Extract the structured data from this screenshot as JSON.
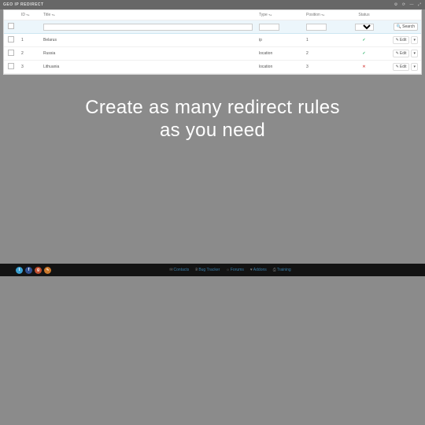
{
  "panel": {
    "title": "GEO IP REDIRECT"
  },
  "table": {
    "headers": {
      "id": "ID",
      "title": "Title",
      "type": "Type",
      "position": "Position",
      "status": "Status"
    },
    "search_label": "Search",
    "edit_label": "Edit",
    "rows": [
      {
        "id": "1",
        "title": "Belarus",
        "type": "ip",
        "position": "1",
        "status": "on"
      },
      {
        "id": "2",
        "title": "Russia",
        "type": "location",
        "position": "2",
        "status": "on"
      },
      {
        "id": "3",
        "title": "Lithuania",
        "type": "location",
        "position": "3",
        "status": "off"
      }
    ]
  },
  "hero": {
    "line1": "Create as many redirect rules",
    "line2": "as you need"
  },
  "footer": {
    "links": [
      {
        "icon": "✉",
        "label": "Contacts"
      },
      {
        "icon": "𐌁",
        "label": "Bug Tracker"
      },
      {
        "icon": "☼",
        "label": "Forums"
      },
      {
        "icon": "♥",
        "label": "Addons"
      },
      {
        "icon": "⎙",
        "label": "Training"
      }
    ]
  }
}
